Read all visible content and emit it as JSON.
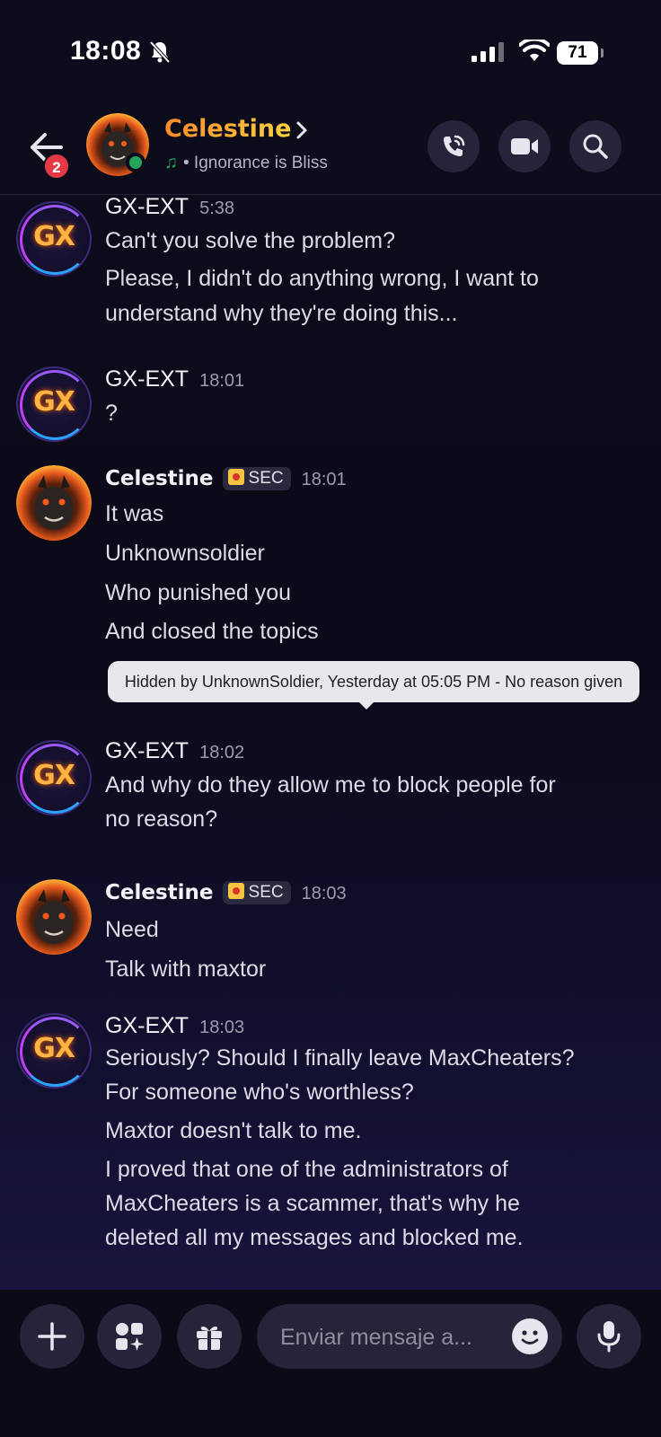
{
  "status_bar": {
    "time": "18:08",
    "battery": "71"
  },
  "header": {
    "name": "Celestine",
    "status_text": "• Ignorance is Bliss",
    "unread_badge": "2"
  },
  "messages": [
    {
      "author": "GX-EXT",
      "time": "5:38",
      "lines": [
        "Can't you solve the problem?",
        "Please, I didn't do anything wrong, I want to",
        "understand why they're doing this..."
      ]
    },
    {
      "author": "GX-EXT",
      "time": "18:01",
      "lines": [
        "?"
      ]
    },
    {
      "author": "Celestine",
      "role": "SEC",
      "time": "18:01",
      "lines": [
        "It was",
        "Unknownsoldier",
        "Who punished you",
        "And closed the topics"
      ]
    },
    {
      "author": "GX-EXT",
      "time": "18:02",
      "lines": [
        "And why do they allow me to block people for",
        "no reason?"
      ]
    },
    {
      "author": "Celestine",
      "role": "SEC",
      "time": "18:03",
      "lines": [
        "Need",
        "Talk with maxtor"
      ]
    },
    {
      "author": "GX-EXT",
      "time": "18:03",
      "lines": [
        "Seriously? Should I finally leave MaxCheaters?",
        "For someone who's worthless?",
        "Maxtor doesn't talk to me.",
        "I proved that one of the administrators of",
        "MaxCheaters is a scammer, that's why he",
        "deleted all my messages and blocked me."
      ]
    }
  ],
  "tooltip": "Hidden by UnknownSoldier, Yesterday at 05:05 PM - No reason given",
  "composer": {
    "placeholder": "Enviar mensaje a..."
  },
  "avatar_text": "GX",
  "colors": {
    "online": "#23a55a",
    "badge": "#e63946",
    "name_gold": "#f7b733"
  },
  "icons": [
    "bell-slash-icon",
    "signal-icon",
    "wifi-icon",
    "back-arrow-icon",
    "chevron-right-icon",
    "music-note-icon",
    "phone-icon",
    "video-icon",
    "search-icon",
    "plus-icon",
    "apps-icon",
    "gift-icon",
    "emoji-icon",
    "microphone-icon"
  ]
}
